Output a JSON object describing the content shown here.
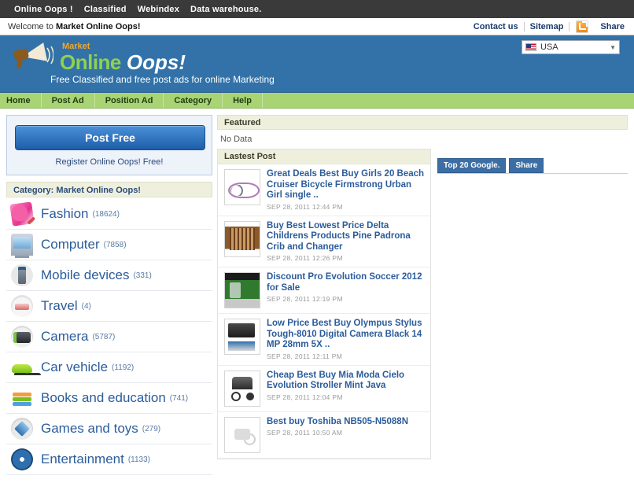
{
  "topbar": {
    "links": [
      {
        "label": "Online Oops !"
      },
      {
        "label": "Classified"
      },
      {
        "label": "Webindex"
      },
      {
        "label": "Data warehouse."
      }
    ]
  },
  "welcome": {
    "prefix": "Welcome to ",
    "site": "Market Online Oops!",
    "contact": "Contact us",
    "sitemap": "Sitemap",
    "rss_icon": "rss-icon",
    "share": "Share"
  },
  "header": {
    "logo": {
      "icon": "megaphone-icon",
      "market": "Market",
      "online": "Online",
      "oops": "Oops!"
    },
    "tagline": "Free Classified and free post ads for online Marketing",
    "country": {
      "flag_icon": "usa-flag-icon",
      "value": "USA",
      "caret_icon": "chevron-down-icon"
    }
  },
  "nav": {
    "items": [
      {
        "label": "Home",
        "name": "nav-home"
      },
      {
        "label": "Post Ad",
        "name": "nav-post-ad"
      },
      {
        "label": "Position Ad",
        "name": "nav-position-ad"
      },
      {
        "label": "Category",
        "name": "nav-category"
      },
      {
        "label": "Help",
        "name": "nav-help"
      }
    ]
  },
  "sidebar": {
    "post_free_button": "Post Free",
    "register_text": "Register Online Oops! Free!",
    "category_header": "Category: Market Online Oops!",
    "categories": [
      {
        "label": "Fashion",
        "count": "(18624)",
        "icon": "fashion-icon"
      },
      {
        "label": "Computer",
        "count": "(7858)",
        "icon": "computer-icon"
      },
      {
        "label": "Mobile devices",
        "count": "(331)",
        "icon": "mobile-icon"
      },
      {
        "label": "Travel",
        "count": "(4)",
        "icon": "travel-icon"
      },
      {
        "label": "Camera",
        "count": "(5787)",
        "icon": "camera-icon"
      },
      {
        "label": "Car vehicle",
        "count": "(1192)",
        "icon": "car-icon"
      },
      {
        "label": "Books and education",
        "count": "(741)",
        "icon": "books-icon"
      },
      {
        "label": "Games and toys",
        "count": "(279)",
        "icon": "games-icon"
      },
      {
        "label": "Entertainment",
        "count": "(1133)",
        "icon": "entertainment-icon"
      }
    ]
  },
  "main": {
    "featured_header": "Featured",
    "featured_empty": "No Data",
    "latest_header": "Lastest Post",
    "posts": [
      {
        "title": "Great Deals Best Buy Girls 20 Beach Cruiser Bicycle Firmstrong Urban Girl single ..",
        "date": "SEP 28, 2011 12:44 PM",
        "thumb": "bicycle-thumbnail"
      },
      {
        "title": "Buy Best Lowest Price Delta Childrens Products Pine Padrona Crib and Changer",
        "date": "SEP 28, 2011 12:26 PM",
        "thumb": "crib-thumbnail"
      },
      {
        "title": "Discount Pro Evolution Soccer 2012 for Sale",
        "date": "SEP 28, 2011 12:19 PM",
        "thumb": "soccer-game-thumbnail"
      },
      {
        "title": "Low Price Best Buy Olympus Stylus Tough-8010 Digital Camera Black 14 MP 28mm 5X ..",
        "date": "SEP 28, 2011 12:11 PM",
        "thumb": "camera-thumbnail"
      },
      {
        "title": "Cheap Best Buy Mia Moda Cielo Evolution Stroller Mint Java",
        "date": "SEP 28, 2011 12:04 PM",
        "thumb": "stroller-thumbnail"
      },
      {
        "title": "Best buy Toshiba NB505-N5088N",
        "date": "SEP 28, 2011 10:50 AM",
        "thumb": "placeholder-thumbnail"
      }
    ],
    "side_tabs": [
      {
        "label": "Top 20 Google."
      },
      {
        "label": "Share"
      }
    ]
  },
  "colors": {
    "topbar": "#3a3a3a",
    "header_blue": "#3272a8",
    "nav_green": "#a8d474",
    "section_cream": "#eef0dd",
    "link_blue": "#2b5c9b",
    "tab_blue": "#3c6ea5",
    "accent_orange": "#f5a623",
    "accent_green": "#8fd14f"
  }
}
